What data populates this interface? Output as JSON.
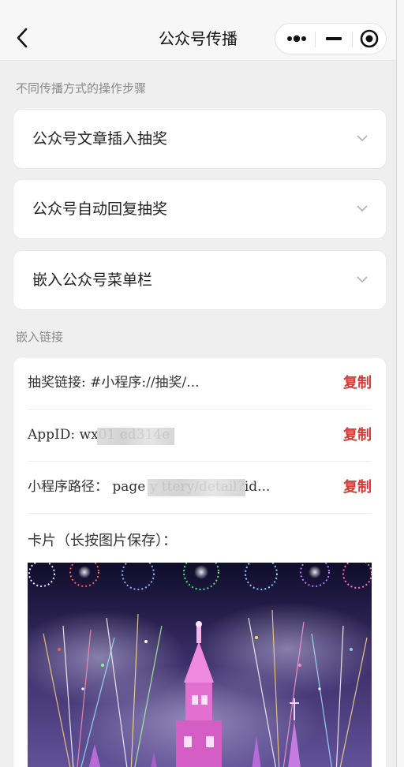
{
  "nav": {
    "title": "公众号传播",
    "back_icon": "chevron-left-icon",
    "more_icon": "more-dots-icon",
    "minimize_icon": "minimize-icon",
    "close_icon": "target-close-icon"
  },
  "section_steps": {
    "label": "不同传播方式的操作步骤",
    "items": [
      {
        "label": "公众号文章插入抽奖"
      },
      {
        "label": "公众号自动回复抽奖"
      },
      {
        "label": "嵌入公众号菜单栏"
      }
    ]
  },
  "section_links": {
    "label": "嵌入链接",
    "rows": [
      {
        "label": "抽奖链接: #小程序://抽奖/...",
        "action": "复制"
      },
      {
        "label": "AppID: wx01            ed314e",
        "action": "复制"
      },
      {
        "label": "小程序路径： page         y    ttery/detail?id...",
        "action": "复制"
      }
    ],
    "card_caption": "卡片（长按图片保存）："
  },
  "colors": {
    "accent": "#d63a34",
    "background": "#efefef",
    "card": "#ffffff"
  }
}
